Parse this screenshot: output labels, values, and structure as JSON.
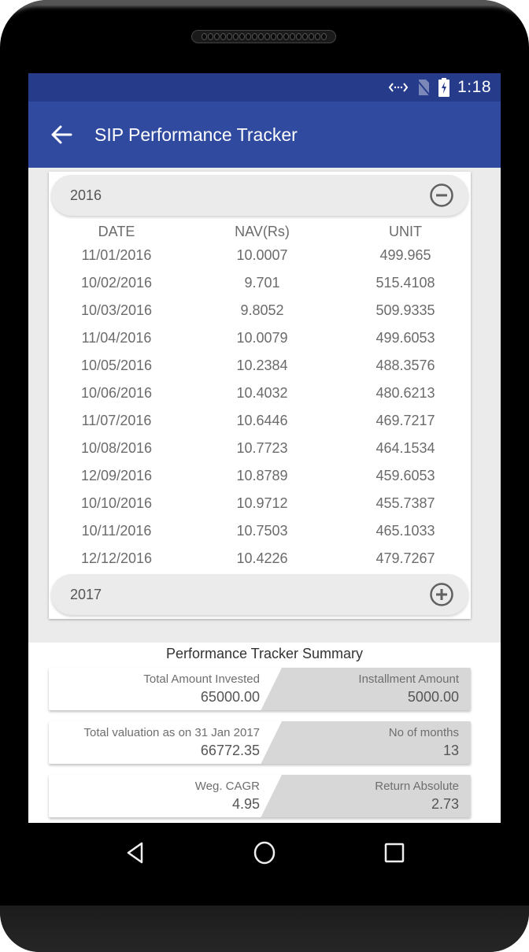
{
  "status_bar": {
    "time": "1:18",
    "icons": [
      "data-arrows-icon",
      "no-sim-icon",
      "battery-charging-icon"
    ]
  },
  "app_bar": {
    "title": "SIP Performance Tracker",
    "back_icon": "arrow-back-icon"
  },
  "accordion": {
    "sections": [
      {
        "year": "2016",
        "expanded": true,
        "toggle_icon": "minus-circle-icon",
        "columns": [
          "DATE",
          "NAV(Rs)",
          "UNIT"
        ],
        "rows": [
          {
            "date": "11/01/2016",
            "nav": "10.0007",
            "unit": "499.965"
          },
          {
            "date": "10/02/2016",
            "nav": "9.701",
            "unit": "515.4108"
          },
          {
            "date": "10/03/2016",
            "nav": "9.8052",
            "unit": "509.9335"
          },
          {
            "date": "11/04/2016",
            "nav": "10.0079",
            "unit": "499.6053"
          },
          {
            "date": "10/05/2016",
            "nav": "10.2384",
            "unit": "488.3576"
          },
          {
            "date": "10/06/2016",
            "nav": "10.4032",
            "unit": "480.6213"
          },
          {
            "date": "11/07/2016",
            "nav": "10.6446",
            "unit": "469.7217"
          },
          {
            "date": "10/08/2016",
            "nav": "10.7723",
            "unit": "464.1534"
          },
          {
            "date": "12/09/2016",
            "nav": "10.8789",
            "unit": "459.6053"
          },
          {
            "date": "10/10/2016",
            "nav": "10.9712",
            "unit": "455.7387"
          },
          {
            "date": "10/11/2016",
            "nav": "10.7503",
            "unit": "465.1033"
          },
          {
            "date": "12/12/2016",
            "nav": "10.4226",
            "unit": "479.7267"
          }
        ]
      },
      {
        "year": "2017",
        "expanded": false,
        "toggle_icon": "plus-circle-icon"
      }
    ]
  },
  "summary": {
    "title": "Performance Tracker Summary",
    "cards": [
      {
        "left": {
          "label": "Total Amount Invested",
          "value": "65000.00"
        },
        "right": {
          "label": "Installment Amount",
          "value": "5000.00"
        }
      },
      {
        "left": {
          "label": "Total valuation as on 31 Jan 2017",
          "value": "66772.35"
        },
        "right": {
          "label": "No of months",
          "value": "13"
        }
      },
      {
        "left": {
          "label": "Weg. CAGR",
          "value": "4.95"
        },
        "right": {
          "label": "Return Absolute",
          "value": "2.73"
        }
      }
    ]
  },
  "nav_bar": {
    "buttons": [
      "back-triangle-icon",
      "home-circle-icon",
      "recents-square-icon"
    ]
  },
  "colors": {
    "status_bar": "#263c8b",
    "app_bar": "#304a9f",
    "background": "#ebebeb",
    "card_gray": "#d7d7d7"
  }
}
